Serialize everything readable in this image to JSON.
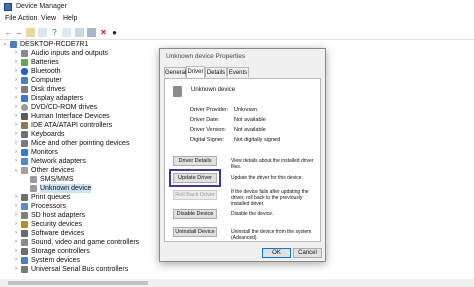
{
  "window": {
    "title": "Device Manager"
  },
  "menu": [
    "File",
    "Action",
    "View",
    "Help"
  ],
  "tree": {
    "root": "DESKTOP-RCDE7R1",
    "items": [
      {
        "label": "Audio inputs and outputs",
        "icon": "speaker-icon"
      },
      {
        "label": "Batteries",
        "icon": "battery-icon"
      },
      {
        "label": "Bluetooth",
        "icon": "bluetooth-icon"
      },
      {
        "label": "Computer",
        "icon": "computer-icon"
      },
      {
        "label": "Disk drives",
        "icon": "disk-icon"
      },
      {
        "label": "Display adapters",
        "icon": "display-icon"
      },
      {
        "label": "DVD/CD-ROM drives",
        "icon": "dvd-icon"
      },
      {
        "label": "Human Interface Devices",
        "icon": "hid-icon"
      },
      {
        "label": "IDE ATA/ATAPI controllers",
        "icon": "ide-icon"
      },
      {
        "label": "Keyboards",
        "icon": "keyboard-icon"
      },
      {
        "label": "Mice and other pointing devices",
        "icon": "mouse-icon"
      },
      {
        "label": "Monitors",
        "icon": "monitor-icon"
      },
      {
        "label": "Network adapters",
        "icon": "network-icon"
      },
      {
        "label": "Other devices",
        "icon": "other-devices-icon"
      },
      {
        "label": "SMS/MMS",
        "icon": "unknown-device-icon"
      },
      {
        "label": "Unknown device",
        "icon": "unknown-device-icon"
      },
      {
        "label": "Print queues",
        "icon": "printer-icon"
      },
      {
        "label": "Processors",
        "icon": "processor-icon"
      },
      {
        "label": "SD host adapters",
        "icon": "sd-icon"
      },
      {
        "label": "Security devices",
        "icon": "security-icon"
      },
      {
        "label": "Software devices",
        "icon": "software-icon"
      },
      {
        "label": "Sound, video and game controllers",
        "icon": "sound-icon"
      },
      {
        "label": "Storage controllers",
        "icon": "storage-icon"
      },
      {
        "label": "System devices",
        "icon": "system-icon"
      },
      {
        "label": "Universal Serial Bus controllers",
        "icon": "usb-icon"
      }
    ]
  },
  "dialog": {
    "title": "Unknown device Properties",
    "tabs": [
      "General",
      "Driver",
      "Details",
      "Events"
    ],
    "active_tab": "Driver",
    "device_name": "Unknown device",
    "props": [
      {
        "key": "Driver Provider:",
        "value": "Unknown"
      },
      {
        "key": "Driver Date:",
        "value": "Not available"
      },
      {
        "key": "Driver Version:",
        "value": "Not available"
      },
      {
        "key": "Digital Signer:",
        "value": "Not digitally signed"
      }
    ],
    "actions": [
      {
        "label": "Driver Details",
        "desc": "View details about the installed driver files."
      },
      {
        "label": "Update Driver",
        "desc": "Update the driver for this device."
      },
      {
        "label": "Roll Back Driver",
        "desc": "If the device fails after updating the driver, roll back to the previously installed driver."
      },
      {
        "label": "Disable Device",
        "desc": "Disable the device."
      },
      {
        "label": "Uninstall Device",
        "desc": "Uninstall the device from the system (Advanced)."
      }
    ],
    "ok": "OK",
    "cancel": "Cancel"
  },
  "colors": {
    "selection": "#cce4f7",
    "highlight_outline": "#3a3b9c",
    "accent": "#0078d7"
  }
}
